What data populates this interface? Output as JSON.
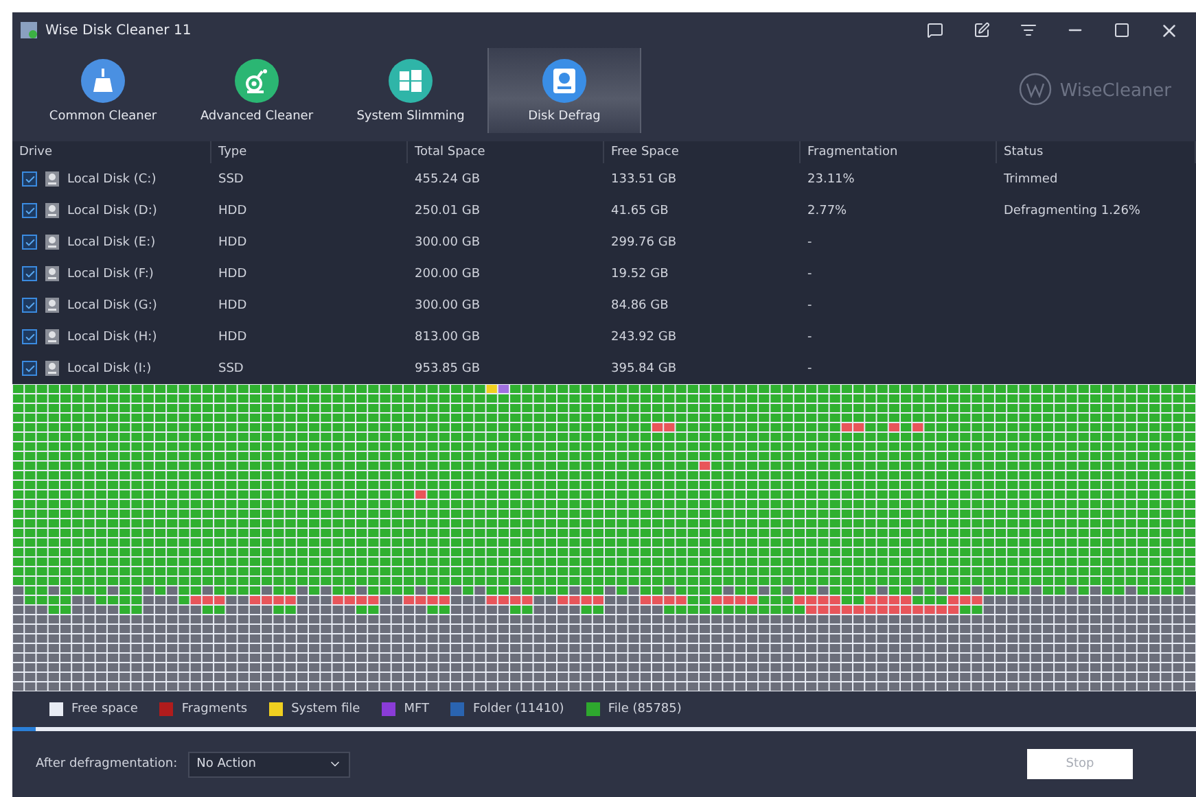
{
  "window": {
    "title": "Wise Disk Cleaner 11"
  },
  "tabs": [
    {
      "label": "Common Cleaner",
      "selected": false,
      "kind": "broom"
    },
    {
      "label": "Advanced Cleaner",
      "selected": false,
      "kind": "vacuum"
    },
    {
      "label": "System Slimming",
      "selected": false,
      "kind": "windows"
    },
    {
      "label": "Disk Defrag",
      "selected": true,
      "kind": "disk"
    }
  ],
  "brand": "WiseCleaner",
  "table": {
    "columns": [
      "Drive",
      "Type",
      "Total Space",
      "Free Space",
      "Fragmentation",
      "Status"
    ],
    "rows": [
      {
        "checked": true,
        "drive": "Local Disk (C:)",
        "type": "SSD",
        "total": "455.24 GB",
        "free": "133.51 GB",
        "fragmentation": "23.11%",
        "status": "Trimmed"
      },
      {
        "checked": true,
        "drive": "Local Disk (D:)",
        "type": "HDD",
        "total": "250.01 GB",
        "free": "41.65 GB",
        "fragmentation": "2.77%",
        "status": "Defragmenting 1.26%"
      },
      {
        "checked": true,
        "drive": "Local Disk (E:)",
        "type": "HDD",
        "total": "300.00 GB",
        "free": "299.76 GB",
        "fragmentation": "-"
      },
      {
        "checked": true,
        "drive": "Local Disk (F:)",
        "type": "HDD",
        "total": "200.00 GB",
        "free": "19.52 GB",
        "fragmentation": "-"
      },
      {
        "checked": true,
        "drive": "Local Disk (G:)",
        "type": "HDD",
        "total": "300.00 GB",
        "free": "84.86 GB",
        "fragmentation": "-"
      },
      {
        "checked": true,
        "drive": "Local Disk (H:)",
        "type": "HDD",
        "total": "813.00 GB",
        "free": "243.92 GB",
        "fragmentation": "-"
      },
      {
        "checked": true,
        "drive": "Local Disk (I:)",
        "type": "SSD",
        "total": "953.85 GB",
        "free": "395.84 GB",
        "fragmentation": "-"
      }
    ]
  },
  "legend": [
    {
      "label": "Free space",
      "color": "#e8ecf4"
    },
    {
      "label": "Fragments",
      "color": "#b01c1c"
    },
    {
      "label": "System file",
      "color": "#f0d020"
    },
    {
      "label": "MFT",
      "color": "#8a3cd8"
    },
    {
      "label": "Folder (11410)",
      "color": "#2a64b0"
    },
    {
      "label": "File (85785)",
      "color": "#2ea82e"
    }
  ],
  "progress": {
    "level": 0.02
  },
  "after": {
    "label": "After defragmentation:",
    "value": "No Action"
  },
  "stop": {
    "label": "Stop",
    "disabled": true
  }
}
